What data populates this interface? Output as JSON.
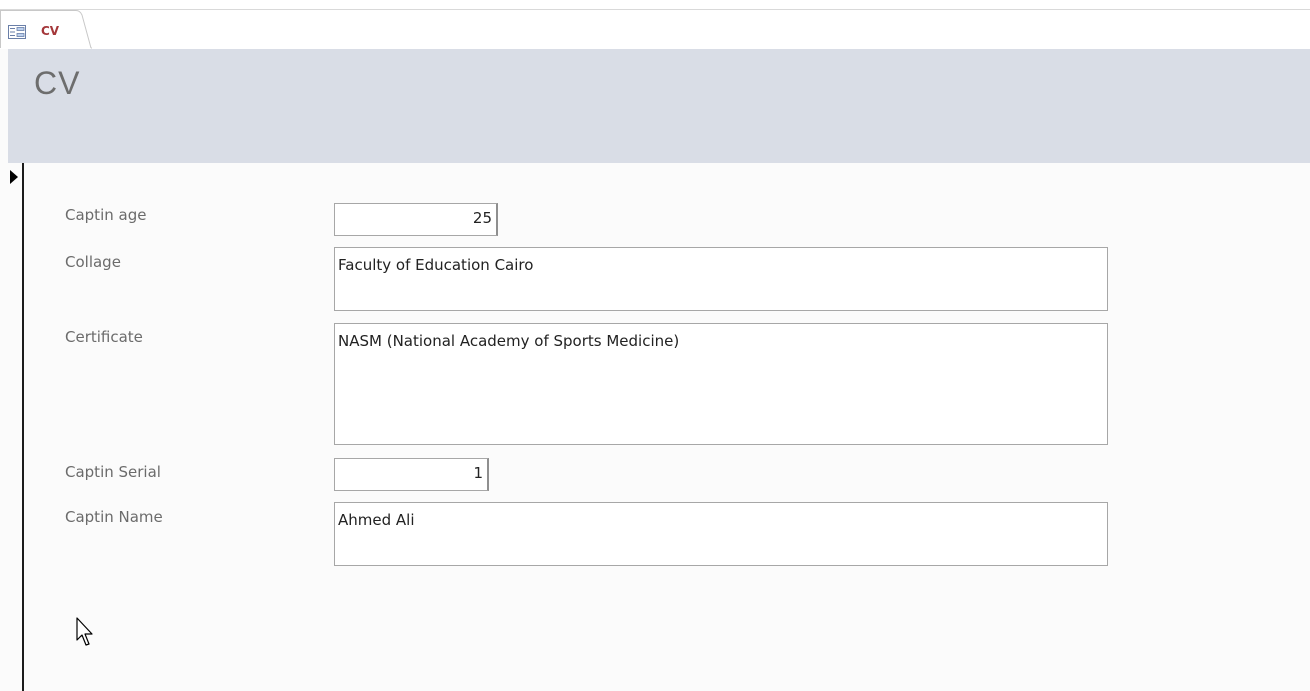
{
  "tab": {
    "label": "CV",
    "icon": "form-icon"
  },
  "header": {
    "title": "CV"
  },
  "fields": {
    "captin_age": {
      "label": "Captin age",
      "value": "25"
    },
    "collage": {
      "label": "Collage",
      "value": "Faculty of Education Cairo"
    },
    "certificate": {
      "label": "Certificate",
      "value": "NASM (National Academy of Sports Medicine)"
    },
    "captin_serial": {
      "label": "Captin Serial",
      "value": "1"
    },
    "captin_name": {
      "label": "Captin Name",
      "value": "Ahmed Ali"
    }
  },
  "colors": {
    "tab_label": "#a4373a",
    "header_bg": "#d9dde6",
    "label_text": "#6b6b6b"
  }
}
